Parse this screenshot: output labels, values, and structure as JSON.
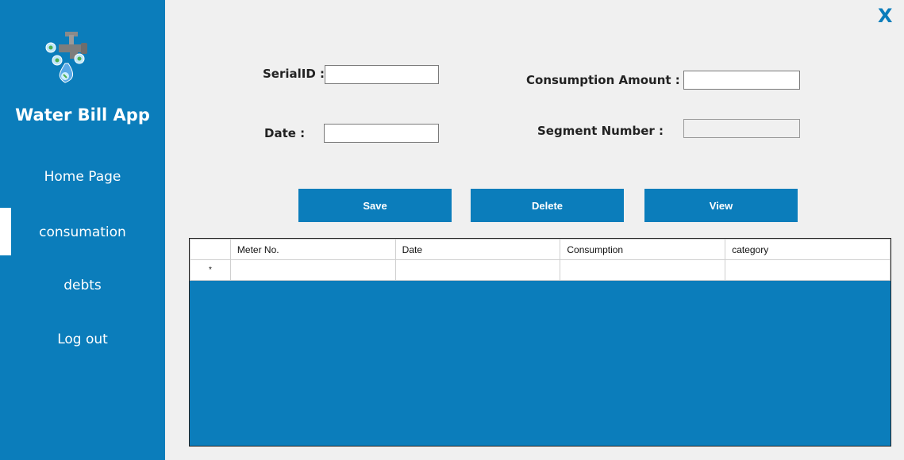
{
  "sidebar": {
    "logo_icon": "water-tap-logo",
    "app_title": "Water Bill App",
    "items": [
      {
        "label": "Home Page"
      },
      {
        "label": "consumation",
        "active": true
      },
      {
        "label": "debts"
      },
      {
        "label": "Log out"
      }
    ]
  },
  "window": {
    "close_label": "X"
  },
  "form": {
    "serial_id": {
      "label": "SerialID :",
      "value": ""
    },
    "date": {
      "label": "Date :",
      "value": ""
    },
    "consumption_amount": {
      "label": "Consumption Amount :",
      "value": ""
    },
    "segment_number": {
      "label": "Segment Number :",
      "value": ""
    }
  },
  "buttons": {
    "save": "Save",
    "delete": "Delete",
    "view": "View"
  },
  "grid": {
    "columns": [
      "Meter No.",
      "Date",
      "Consumption",
      "category"
    ],
    "new_row_marker": "*"
  },
  "colors": {
    "accent": "#0b7dbb",
    "background": "#f0f0f0"
  }
}
